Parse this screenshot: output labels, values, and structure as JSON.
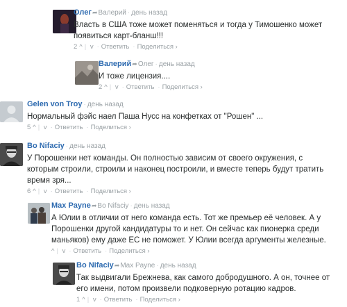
{
  "comments": [
    {
      "author": "Олег",
      "reply_to": "Валерий",
      "time": "день назад",
      "lines": [
        "Власть в США тоже может поменяться и тогда у Тимошенко может",
        "появиться карт-бланш!!!"
      ],
      "upvotes": "2",
      "up_icon": "^",
      "down_icon": "v",
      "reply_label": "Ответить",
      "share_label": "Поделиться ›",
      "avatar": "dark-figure-avatar"
    },
    {
      "author": "Валерий",
      "reply_to": "Олег",
      "time": "день назад",
      "lines": [
        "И тоже лицензия...."
      ],
      "upvotes": "2",
      "up_icon": "^",
      "down_icon": "v",
      "reply_label": "Ответить",
      "share_label": "Поделиться ›",
      "avatar": "grey-photo-avatar"
    },
    {
      "author": "Gelen von Troy",
      "reply_to": "",
      "time": "день назад",
      "lines": [
        "Нормальный фэйс наел Паша Нусс на конфетках от \"Рошен\" ..."
      ],
      "upvotes": "5",
      "up_icon": "^",
      "down_icon": "v",
      "reply_label": "Ответить",
      "share_label": "Поделиться ›",
      "avatar": "default-user-avatar"
    },
    {
      "author": "Bo Nifaciy",
      "reply_to": "",
      "time": "день назад",
      "lines": [
        "У Порошенки нет команды. Он полностью зависим от своего окружения, с",
        "которым строили, строили и наконец построили, и вместе теперь будут тратить",
        "время зря..."
      ],
      "upvotes": "6",
      "up_icon": "^",
      "down_icon": "v",
      "reply_label": "Ответить",
      "share_label": "Поделиться ›",
      "avatar": "man-portrait-avatar"
    },
    {
      "author": "Max Payne",
      "reply_to": "Bo Nifaciy",
      "time": "день назад",
      "lines": [
        "А Юлии в отличии от него команда есть. Тот же премьер её человек. А у",
        "Порошенки другой кандидатуры то и нет. Он сейчас как пионерка среди",
        "маньяков) ему даже ЕС не поможет. У Юлии всегда аргументы железные."
      ],
      "upvotes": "",
      "up_icon": "^",
      "down_icon": "v",
      "reply_label": "Ответить",
      "share_label": "Поделиться ›",
      "avatar": "group-photo-avatar"
    },
    {
      "author": "Bo Nifaciy",
      "reply_to": "Max Payne",
      "time": "день назад",
      "lines": [
        "Так выдвигали Брежнева, как самого добродушного. А он, точнее от",
        "его имени, потом произвели подковерную ротацию кадров."
      ],
      "upvotes": "1",
      "up_icon": "^",
      "down_icon": "v",
      "reply_label": "Ответить",
      "share_label": "Поделиться ›",
      "avatar": "man-portrait-avatar"
    }
  ]
}
